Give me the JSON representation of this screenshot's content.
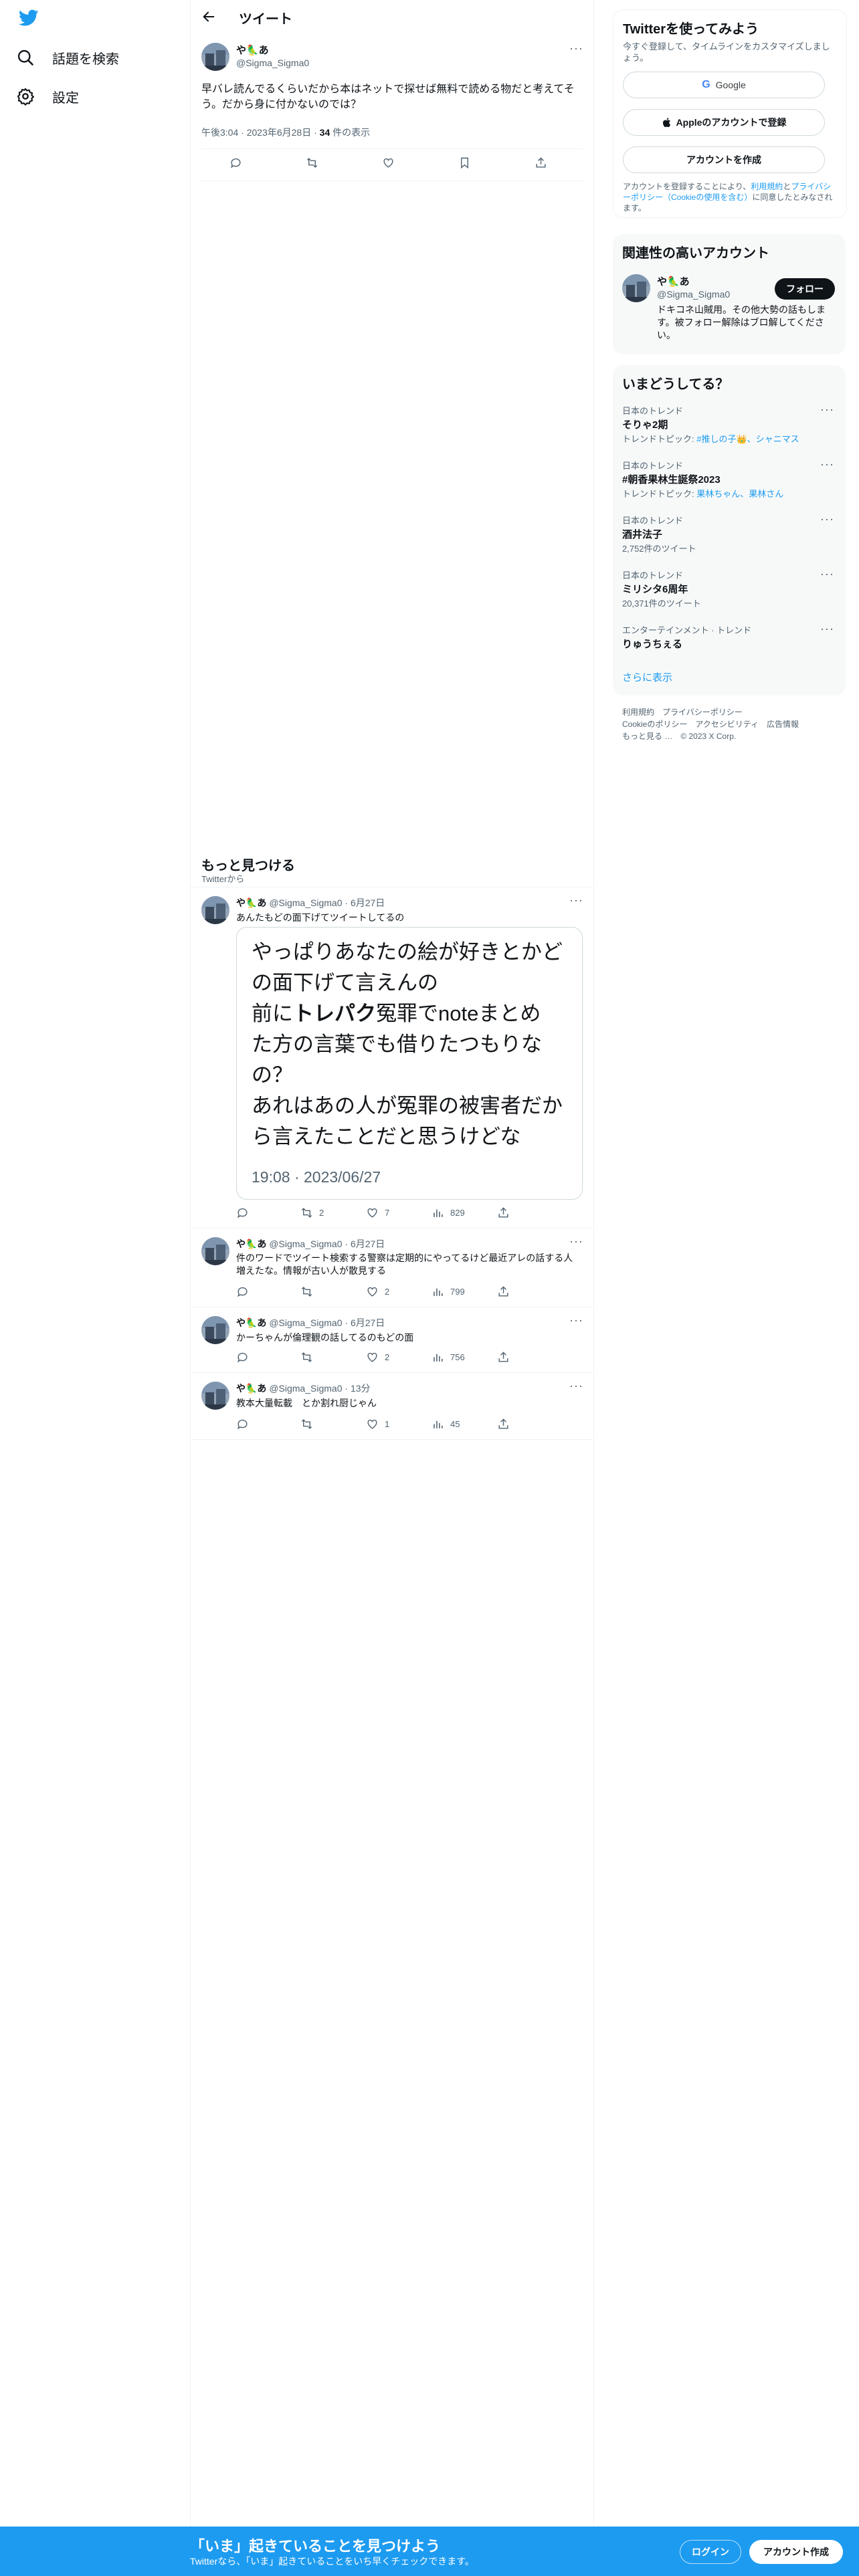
{
  "nav": {
    "explore_label": "話題を検索",
    "settings_label": "設定"
  },
  "header": {
    "title": "ツイート"
  },
  "tweet": {
    "display_name": "や🦜あ",
    "handle": "@Sigma_Sigma0",
    "text": "早バレ読んでるくらいだから本はネットで探せば無料で読める物だと考えてそう。だから身に付かないのでは？",
    "time": "午後3:04",
    "date": "2023年6月28日",
    "views_count": "34",
    "views_label": "件の表示"
  },
  "discover": {
    "title": "もっと見つける",
    "subtitle": "Twitterから"
  },
  "replies": [
    {
      "display_name": "や🦜あ",
      "handle": "@Sigma_Sigma0",
      "date": "6月27日",
      "text": "あんたもどの面下げてツイートしてるの",
      "quote": {
        "line1": "やっぱりあなたの絵が好きとかど",
        "line2": "の面下げて言えんの",
        "line3_pre": "前に",
        "line3_bold": "トレパク",
        "line3_post": "冤罪でnoteまとめ",
        "line4": "た方の言葉でも借りたつもりなの？",
        "line5": "あれはあの人が冤罪の被害者だか",
        "line6": "ら言えたことだと思うけどな",
        "timestamp": "19:08 · 2023/06/27"
      },
      "retweets": "2",
      "likes": "7",
      "views": "829"
    },
    {
      "display_name": "や🦜あ",
      "handle": "@Sigma_Sigma0",
      "date": "6月27日",
      "text": "件のワードでツイート検索する警察は定期的にやってるけど最近アレの話する人増えたな。情報が古い人が散見する",
      "retweets": "",
      "likes": "2",
      "views": "799"
    },
    {
      "display_name": "や🦜あ",
      "handle": "@Sigma_Sigma0",
      "date": "6月27日",
      "text": "かーちゃんが倫理観の話してるのもどの面",
      "retweets": "",
      "likes": "2",
      "views": "756"
    },
    {
      "display_name": "や🦜あ",
      "handle": "@Sigma_Sigma0",
      "date": "13分",
      "text": "教本大量転載　とか割れ厨じゃん",
      "retweets": "",
      "likes": "1",
      "views": "45"
    }
  ],
  "signup": {
    "title": "Twitterを使ってみよう",
    "subtitle": "今すぐ登録して、タイムラインをカスタマイズしましょう。",
    "google_label": "Google",
    "apple_label": "Appleのアカウントで登録",
    "create_label": "アカウントを作成",
    "terms_pre": "アカウントを登録することにより、",
    "terms_link1": "利用規約",
    "terms_and": "と",
    "terms_link2": "プライバシーポリシー（Cookieの使用を含む）",
    "terms_post": "に同意したとみなされます。"
  },
  "relevant": {
    "title": "関連性の高いアカウント",
    "display_name": "や🦜あ",
    "handle": "@Sigma_Sigma0",
    "bio": "ドキコネ山賊用。その他大勢の話もします。被フォロー解除はブロ解してください。",
    "follow_label": "フォロー"
  },
  "trends": {
    "title": "いまどうしてる？",
    "items": [
      {
        "context": "日本のトレンド",
        "name": "そりゃ2期",
        "extra_pre": "トレンドトピック: ",
        "extra_link": "#推しの子👑、シャニマス",
        "extra_post": ""
      },
      {
        "context": "日本のトレンド",
        "name": "#朝香果林生誕祭2023",
        "extra_pre": "トレンドトピック: ",
        "extra_link": "果林ちゃん、果林さん",
        "extra_post": ""
      },
      {
        "context": "日本のトレンド",
        "name": "酒井法子",
        "extra_pre": "2,752件のツイート",
        "extra_link": "",
        "extra_post": ""
      },
      {
        "context": "日本のトレンド",
        "name": "ミリシタ6周年",
        "extra_pre": "20,371件のツイート",
        "extra_link": "",
        "extra_post": ""
      },
      {
        "context": "エンターテインメント · トレンド",
        "name": "りゅうちぇる",
        "extra_pre": "",
        "extra_link": "",
        "extra_post": ""
      }
    ],
    "show_more": "さらに表示"
  },
  "footer": {
    "line1": "利用規約　プライバシーポリシー",
    "line2": "Cookieのポリシー　アクセシビリティ　広告情報",
    "line3": "もっと見る …　© 2023 X Corp."
  },
  "bottombar": {
    "title": "「いま」起きていることを見つけよう",
    "subtitle": "Twitterなら、「いま」起きていることをいち早くチェックできます。",
    "login_label": "ログイン",
    "signup_label": "アカウント作成"
  },
  "colors": {
    "accent": "#1d9bf0",
    "text": "#0f1419",
    "muted": "#536471"
  }
}
